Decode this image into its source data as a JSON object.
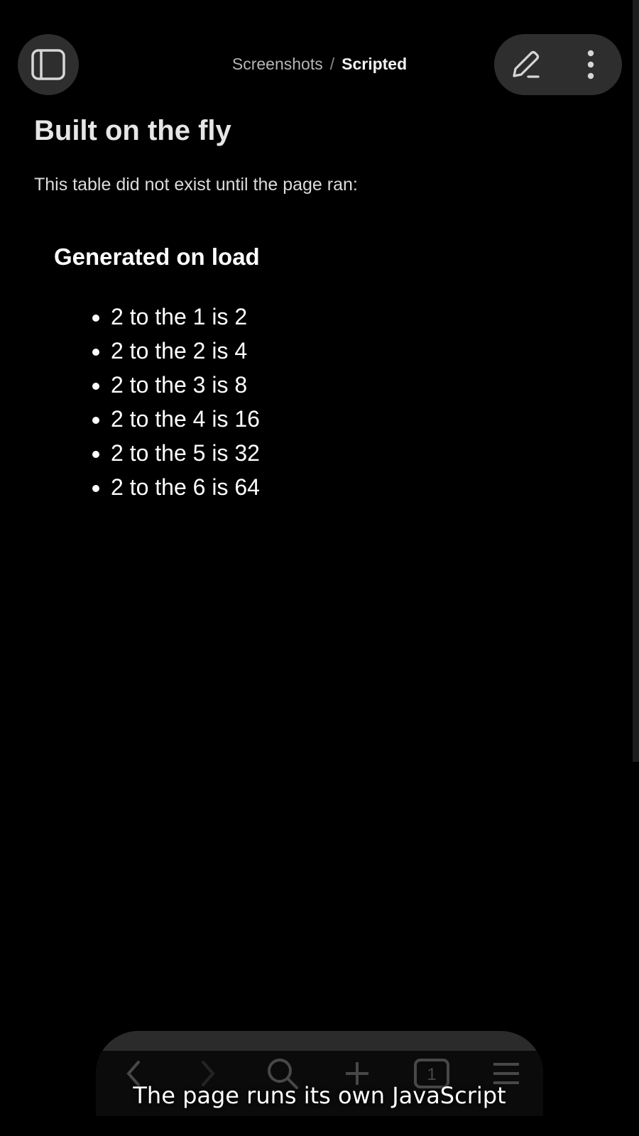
{
  "breadcrumb": {
    "parent": "Screenshots",
    "separator": "/",
    "current": "Scripted"
  },
  "main": {
    "title": "Built on the fly",
    "intro": "This table did not exist until the page ran:"
  },
  "generated": {
    "heading": "Generated on load",
    "items": [
      "2 to the 1 is 2",
      "2 to the 2 is 4",
      "2 to the 3 is 8",
      "2 to the 4 is 16",
      "2 to the 5 is 32",
      "2 to the 6 is 64"
    ]
  },
  "toolbar": {
    "tab_count": "1",
    "icons": [
      "back-icon",
      "forward-icon",
      "search-icon",
      "add-icon",
      "tabs-icon",
      "menu-icon"
    ]
  },
  "caption": "The page runs its own JavaScript",
  "colors": {
    "background": "#000000",
    "button_bg": "#2e2e2e",
    "text": "#e6e6e6"
  }
}
